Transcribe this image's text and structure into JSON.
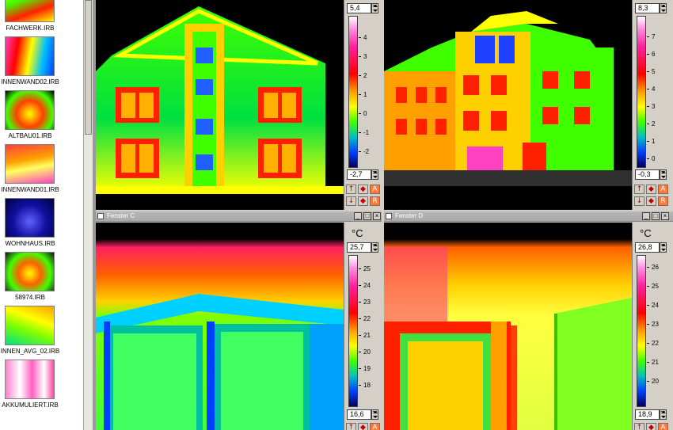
{
  "thumbnails": [
    {
      "label": "FACHWERK.IRB"
    },
    {
      "label": "INNENWAND02.IRB"
    },
    {
      "label": "ALTBAU01.IRB"
    },
    {
      "label": "INNENWAND01.IRB"
    },
    {
      "label": "WOHNHAUS.IRB"
    },
    {
      "label": "58974.IRB"
    },
    {
      "label": "INNEN_AVG_02.IRB"
    },
    {
      "label": "AKKUMULIERT.IRB"
    }
  ],
  "windows": {
    "a": {
      "max": "5,4",
      "min": "-2,7",
      "ticks": [
        "4",
        "3",
        "2",
        "1",
        "0",
        "-1",
        "-2"
      ]
    },
    "b": {
      "max": "8,3",
      "min": "-0,3",
      "ticks": [
        "7",
        "6",
        "5",
        "4",
        "3",
        "2",
        "1",
        "0"
      ]
    },
    "c": {
      "title": "Fenster C",
      "unit": "°C",
      "max": "25,7",
      "min": "16,6",
      "ticks": [
        "25",
        "24",
        "23",
        "22",
        "21",
        "20",
        "19",
        "18"
      ]
    },
    "d": {
      "title": "Fenster D",
      "unit": "°C",
      "max": "26,8",
      "min": "18,9",
      "ticks": [
        "26",
        "25",
        "24",
        "23",
        "22",
        "21",
        "20"
      ]
    }
  },
  "window_buttons": {
    "minimize": "_",
    "maximize": "□",
    "close": "×"
  },
  "toolbar_glyphs": {
    "up": "↑",
    "swap": "◆",
    "auto": "A",
    "down": "↓",
    "swap2": "◆",
    "reset": "R"
  },
  "colors": {
    "palette_top": "#ffffff",
    "palette_hot": "#ff0000",
    "palette_mid": "#ffff00",
    "palette_cold": "#000060",
    "accent_button": "#ff7a3a"
  }
}
